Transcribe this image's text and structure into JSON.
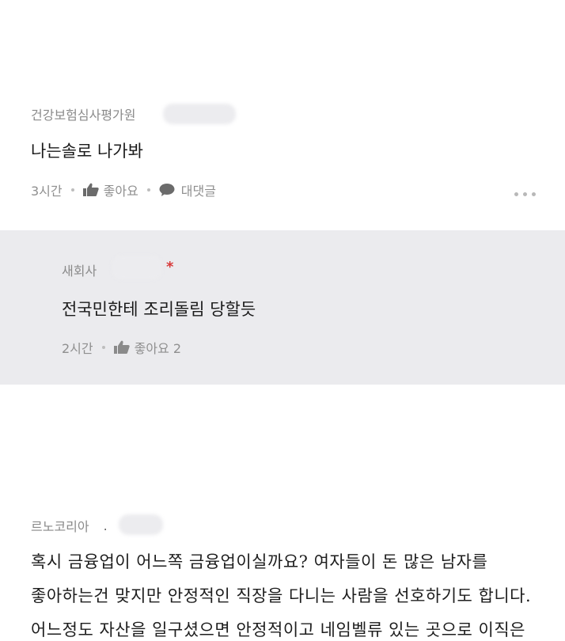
{
  "comments": [
    {
      "author": "건강보험심사평가원",
      "text": "나는솔로 나가봐",
      "time": "3시간",
      "like_label": "좋아요",
      "reply_label": "대댓글"
    }
  ],
  "reply": {
    "author": "새회사",
    "marker": "*",
    "text": "전국민한테 조리돌림 당할듯",
    "time": "2시간",
    "like_label": "좋아요 2"
  },
  "bottom": {
    "author": "르노코리아",
    "author_suffix": ".",
    "lines": [
      "혹시 금융업이 어느쪽 금융업이실까요? 여자들이 돈 많은 남자를",
      "좋아하는건 맞지만 안정적인 직장을 다니는 사람을 선호하기도 합니다.",
      "어느정도 자산을 일구셨으면 안정적이고 네임벨류 있는 곳으로 이직은"
    ]
  },
  "icons": [
    "thumbs-up-icon",
    "speech-bubble-icon",
    "more-dots-icon"
  ],
  "colors": {
    "reply_bg": "#ebebee",
    "marker": "#d83a3a",
    "meta": "#8f8f8f"
  }
}
